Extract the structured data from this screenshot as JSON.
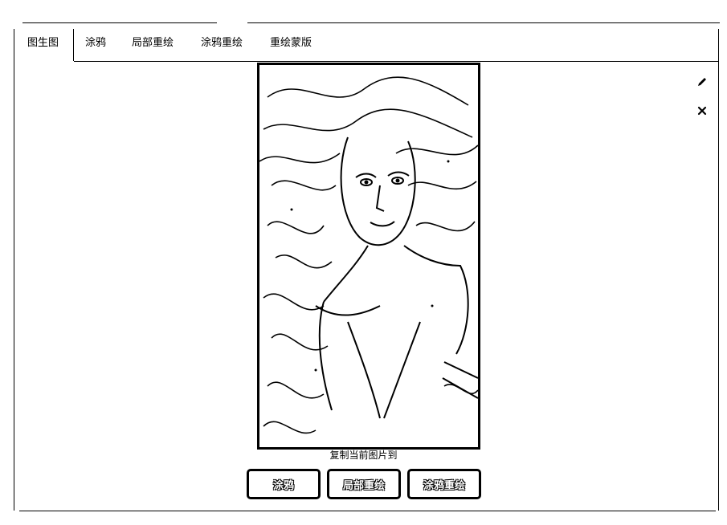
{
  "tabs": [
    {
      "label": "图生图"
    },
    {
      "label": "涂鸦"
    },
    {
      "label": "局部重绘"
    },
    {
      "label": "涂鸦重绘"
    },
    {
      "label": "重绘蒙版"
    }
  ],
  "image_panel": {
    "edit_icon": "pencil-icon",
    "close_icon": "close-icon",
    "image_description_icon": "portrait-image"
  },
  "copy_section": {
    "label": "复制当前图片到",
    "buttons": [
      {
        "label": "涂鸦"
      },
      {
        "label": "局部重绘"
      },
      {
        "label": "涂鸦重绘"
      }
    ]
  }
}
